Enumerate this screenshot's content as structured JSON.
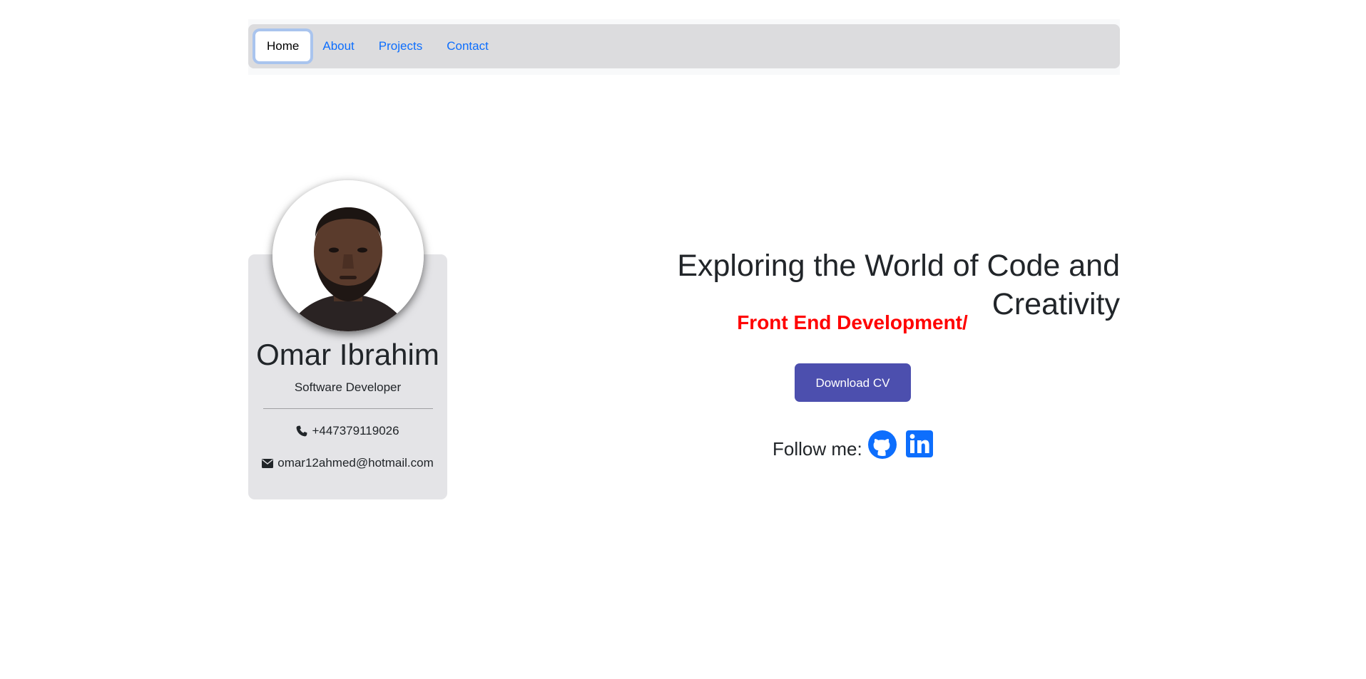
{
  "nav": {
    "items": [
      {
        "label": "Home",
        "active": true
      },
      {
        "label": "About",
        "active": false
      },
      {
        "label": "Projects",
        "active": false
      },
      {
        "label": "Contact",
        "active": false
      }
    ]
  },
  "profile": {
    "name": "Omar Ibrahim",
    "role": "Software Developer",
    "phone": "+447379119026",
    "email": "omar12ahmed@hotmail.com",
    "avatar_icon": "profile-photo",
    "phone_icon": "phone-icon",
    "email_icon": "envelope-icon"
  },
  "hero": {
    "title": "Exploring the World of Code and Creativity",
    "subtitle": "Front End Development/",
    "cv_button": "Download CV",
    "follow_label": "Follow me:",
    "social": [
      {
        "icon": "github-icon"
      },
      {
        "icon": "linkedin-icon"
      }
    ]
  },
  "colors": {
    "accent_link": "#0d6efd",
    "subtitle": "#ff0000",
    "cv_button": "#4c4fae",
    "card_bg": "#e4e4e7"
  }
}
